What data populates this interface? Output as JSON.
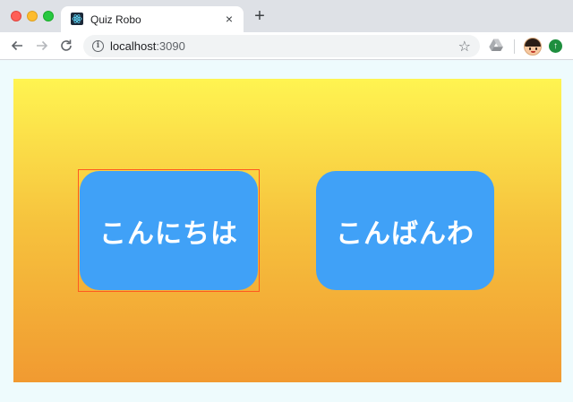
{
  "browser": {
    "tab": {
      "title": "Quiz Robo",
      "favicon": "react-atom-icon",
      "close_glyph": "×"
    },
    "new_tab_glyph": "+",
    "address_bar": {
      "host": "localhost",
      "port": ":3090"
    },
    "icons": {
      "back": "arrow-left-icon",
      "forward": "arrow-right-icon",
      "reload": "reload-icon",
      "info": "info-icon",
      "bookmark": "star-icon",
      "drive_extension": "google-drive-icon",
      "profile": "avatar",
      "update": "update-arrow-icon"
    },
    "info_glyph": "i",
    "star_glyph": "☆",
    "update_glyph": "↑"
  },
  "quiz": {
    "choices": [
      {
        "label": "こんにちは",
        "focused": true
      },
      {
        "label": "こんばんわ",
        "focused": false
      }
    ]
  },
  "colors": {
    "button": "#40a1f7",
    "gradient_top": "#fff451",
    "gradient_bottom": "#f19a31",
    "focus_outline": "#ff5a1f"
  }
}
